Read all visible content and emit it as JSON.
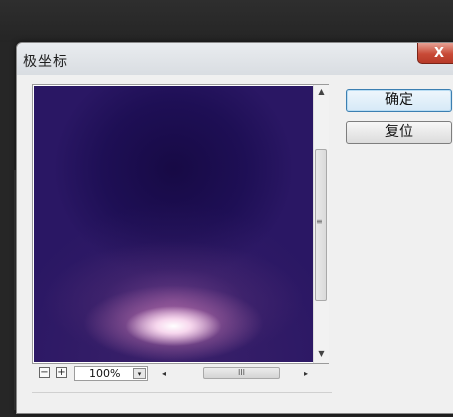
{
  "dialog": {
    "title": "极坐标",
    "close_label": "X"
  },
  "buttons": {
    "ok_label": "确定",
    "reset_label": "复位"
  },
  "preview": {
    "zoom_value": "100%",
    "zoom_out_label": "−",
    "zoom_in_label": "+",
    "zoom_dropdown_glyph": "▾",
    "hscroll_grip": "III",
    "vscroll_grip": "≡",
    "arrow_up": "▲",
    "arrow_down": "▼",
    "arrow_left": "◂",
    "arrow_right": "▸"
  },
  "colors": {
    "preview_dark": "#1e0f55",
    "preview_glow": "#f7d8ee",
    "close_button": "#c84a37",
    "default_button_border": "#3c7fb1"
  }
}
